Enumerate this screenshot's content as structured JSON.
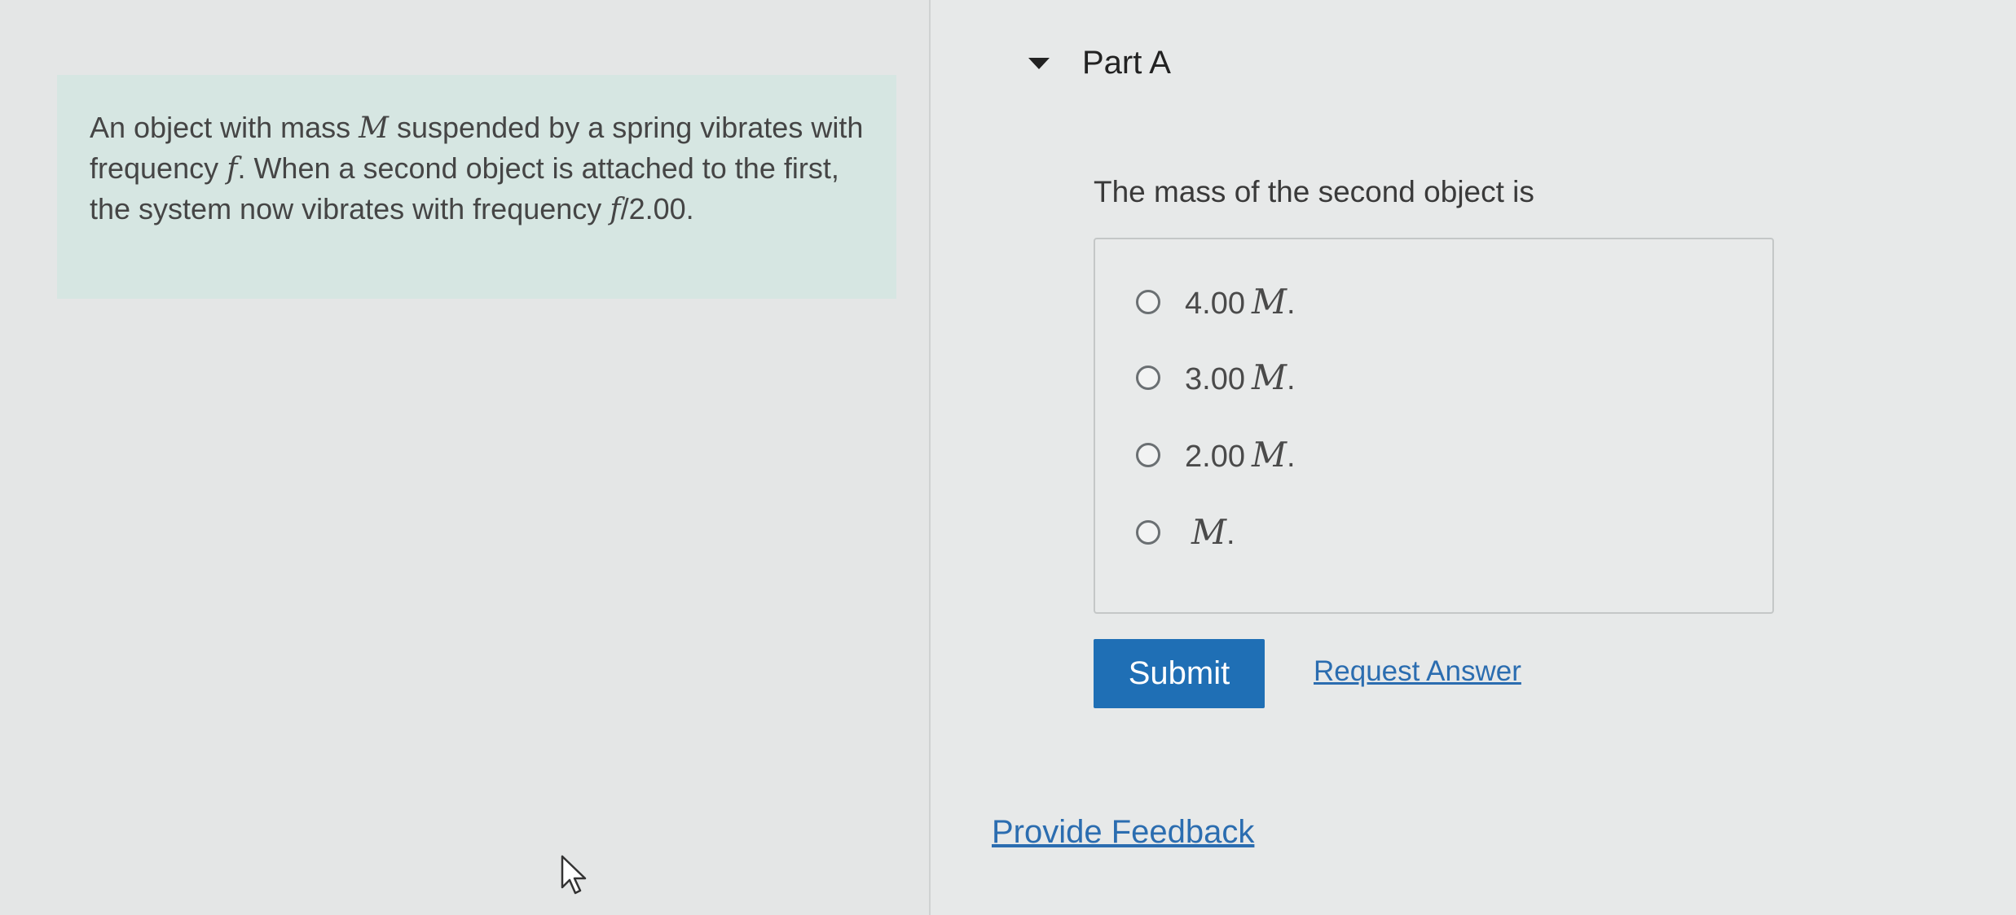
{
  "problem": {
    "t1": "An object with mass ",
    "m1": "M",
    "t2": " suspended by a spring vibrates with frequency ",
    "f1": "f",
    "t3": ". When a second object is attached to the first, the system now vibrates with frequency ",
    "f2": "f",
    "t4": "/2.00."
  },
  "part": {
    "title": "Part A"
  },
  "question": {
    "text": "The mass of the second object is"
  },
  "choices": [
    {
      "value": "4.00",
      "var": "M",
      "suffix": "."
    },
    {
      "value": "3.00",
      "var": "M",
      "suffix": "."
    },
    {
      "value": "2.00",
      "var": "M",
      "suffix": "."
    },
    {
      "value": "",
      "var": "M",
      "suffix": "."
    }
  ],
  "actions": {
    "submit_label": "Submit",
    "request_answer_label": "Request Answer",
    "feedback_label": "Provide Feedback"
  },
  "colors": {
    "submit_bg": "#1f6fb5",
    "link": "#2b6db0",
    "problem_bg": "#d6e6e2"
  },
  "icons": [
    "caret-down-icon",
    "radio-icon",
    "mouse-cursor-icon"
  ]
}
